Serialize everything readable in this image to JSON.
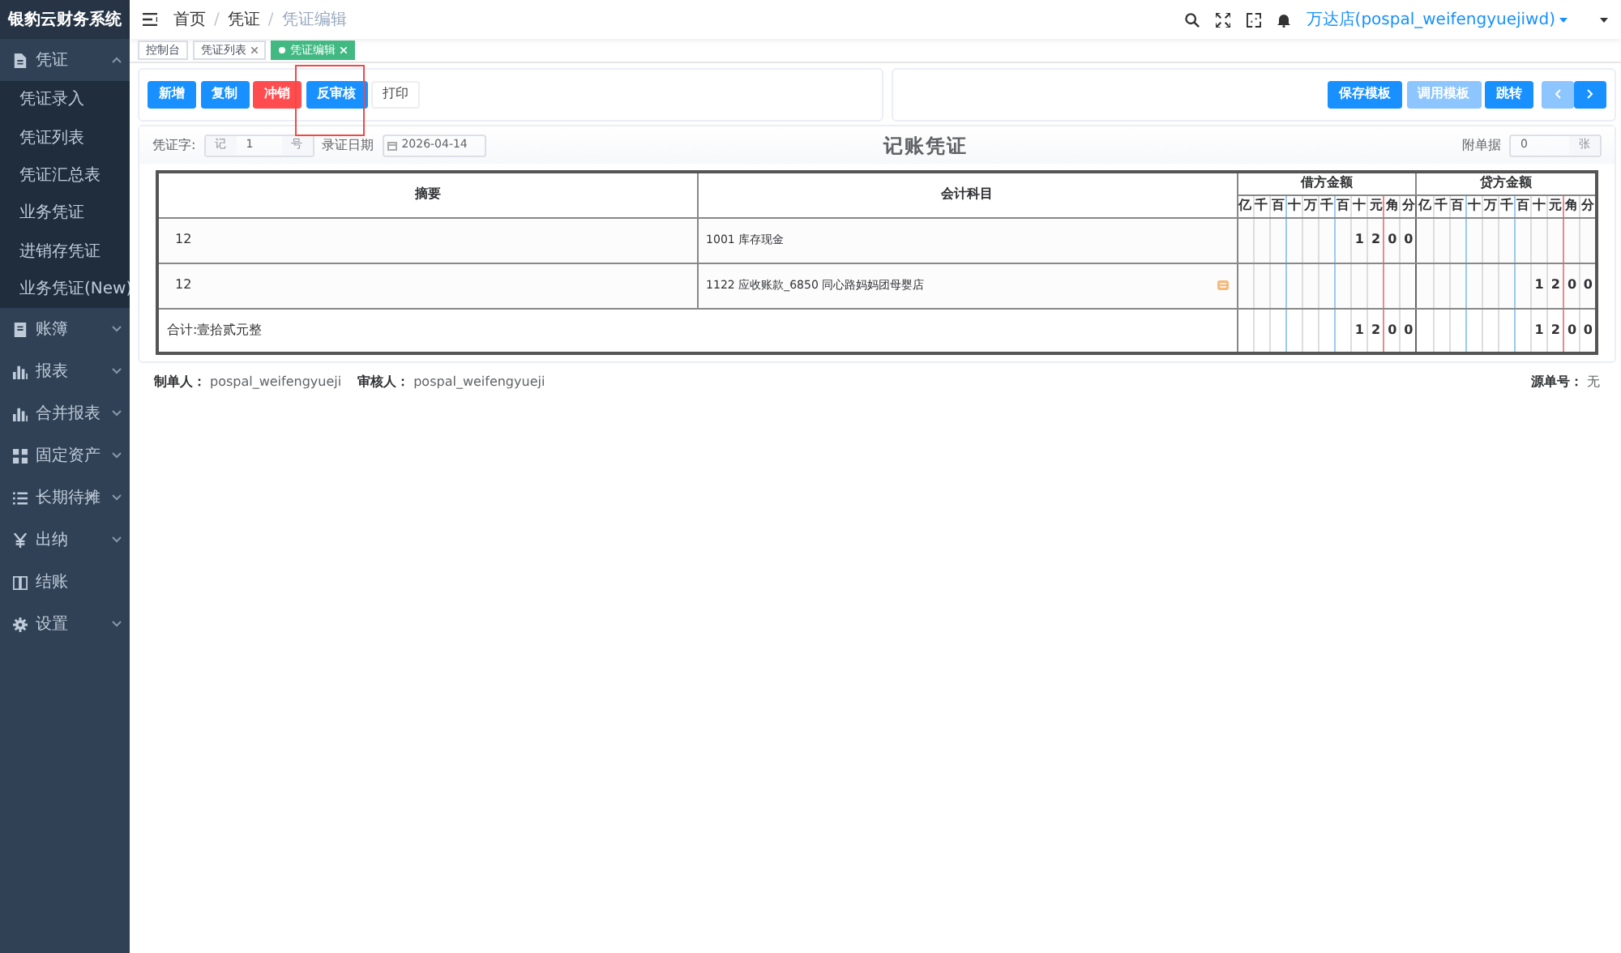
{
  "sidebar": {
    "title": "银豹云财务系统",
    "items": [
      {
        "label": "凭证",
        "expanded": true,
        "children": [
          {
            "label": "凭证录入",
            "selected": false
          },
          {
            "label": "凭证列表",
            "selected": false
          },
          {
            "label": "凭证汇总表",
            "selected": false
          },
          {
            "label": "业务凭证",
            "selected": false
          },
          {
            "label": "进销存凭证",
            "selected": false
          },
          {
            "label": "业务凭证(New)",
            "selected": false
          }
        ]
      },
      {
        "label": "账簿",
        "expanded": false
      },
      {
        "label": "报表",
        "expanded": false
      },
      {
        "label": "合并报表",
        "expanded": false
      },
      {
        "label": "固定资产",
        "expanded": false
      },
      {
        "label": "长期待摊",
        "expanded": false
      },
      {
        "label": "出纳",
        "expanded": false
      },
      {
        "label": "结账"
      },
      {
        "label": "设置",
        "expanded": false
      }
    ]
  },
  "header": {
    "breadcrumb": [
      "首页",
      "凭证",
      "凭证编辑"
    ],
    "separators": [
      "/",
      "/"
    ],
    "user": "万达店(pospal_weifengyuejiwd)"
  },
  "tabs": [
    {
      "label": "控制台",
      "closable": false,
      "selected": false
    },
    {
      "label": "凭证列表",
      "closable": true,
      "selected": false
    },
    {
      "label": "凭证编辑",
      "closable": true,
      "selected": true
    }
  ],
  "toolbar_left": [
    {
      "label": "新增",
      "kind": "primary",
      "highlighted": false
    },
    {
      "label": "复制",
      "kind": "primary",
      "highlighted": false
    },
    {
      "label": "冲销",
      "kind": "danger",
      "highlighted": false
    },
    {
      "label": "反审核",
      "kind": "primary",
      "highlighted": true
    },
    {
      "label": "打印",
      "kind": "plain",
      "highlighted": false
    }
  ],
  "toolbar_right": [
    {
      "label": "保存模板",
      "disabled": false
    },
    {
      "label": "调用模板",
      "disabled": true
    },
    {
      "label": "跳转",
      "disabled": false
    }
  ],
  "pager": {
    "prev_disabled": true,
    "next_disabled": false
  },
  "voucher": {
    "word_label": "凭证字:",
    "word_prefix": "记",
    "number": "1",
    "word_suffix": "号",
    "date_label": "录证日期",
    "date": "2026-04-14",
    "title": "记账凭证",
    "attach_label": "附单据",
    "attach_count": "0",
    "attach_suffix": "张"
  },
  "table": {
    "columns": [
      "摘要",
      "会计科目",
      "借方金额",
      "贷方金额"
    ],
    "debit_units": [
      "亿",
      "千",
      "百",
      "十",
      "万",
      "千",
      "百",
      "十",
      "元",
      "角",
      "分"
    ],
    "credit_units": [
      "亿",
      "千",
      "百",
      "十",
      "万",
      "千",
      "百",
      "十",
      "元",
      "角",
      "分"
    ],
    "rows": [
      {
        "summary": "12",
        "account": "1001 库存现金",
        "debit": [
          "1",
          "2",
          "0",
          "0"
        ],
        "credit": [],
        "has_detail": false
      },
      {
        "summary": "12",
        "account": "1122 应收账款_6850 同心路妈妈团母婴店",
        "debit": [],
        "credit": [
          "1",
          "2",
          "0",
          "0"
        ],
        "has_detail": true
      }
    ],
    "total": {
      "label": "合计:壹拾贰元整",
      "debit": [
        "1",
        "2",
        "0",
        "0"
      ],
      "credit": [
        "1",
        "2",
        "0",
        "0"
      ]
    }
  },
  "footer": {
    "maker_label": "制单人：",
    "maker": "pospal_weifengyueji",
    "checker_label": "审核人：",
    "checker": "pospal_weifengyueji",
    "source_label": "源单号：",
    "source": "无"
  }
}
